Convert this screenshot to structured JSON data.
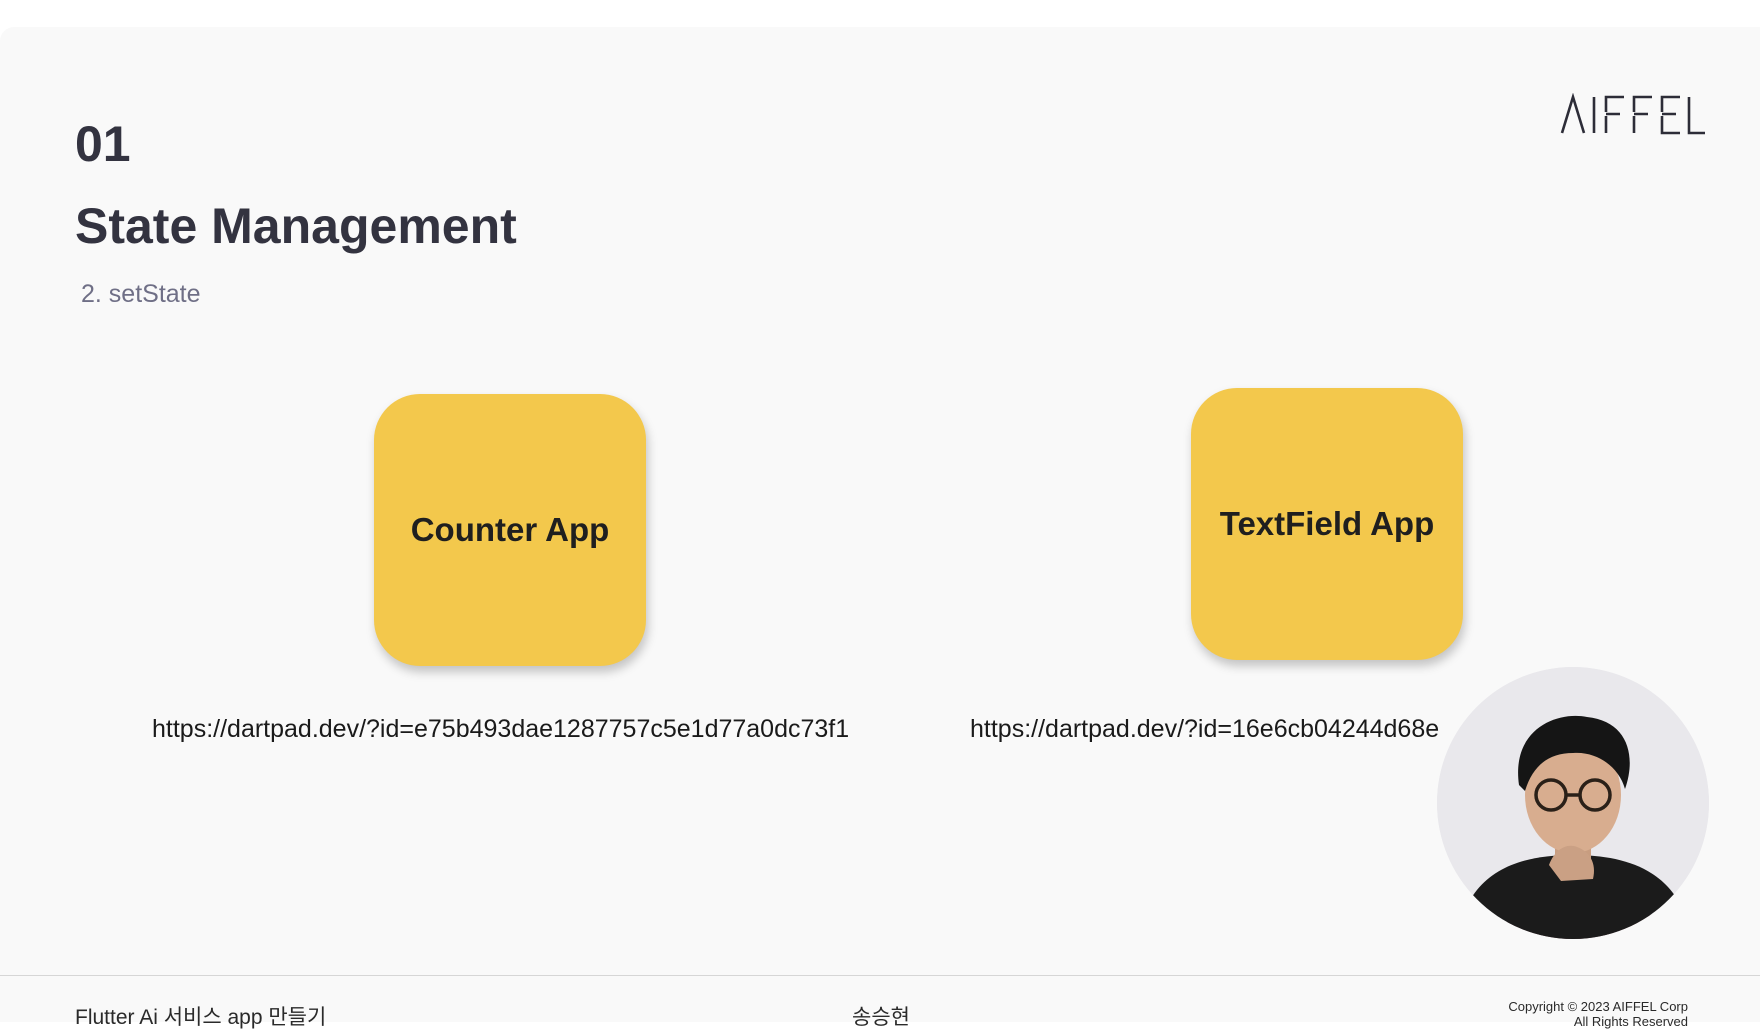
{
  "slide": {
    "section_number": "01",
    "title": "State Management",
    "subtitle": "2. setState",
    "logo_text": "AIFFEL"
  },
  "cards": {
    "counter": {
      "label": "Counter App",
      "url": "https://dartpad.dev/?id=e75b493dae1287757c5e1d77a0dc73f1"
    },
    "textfield": {
      "label": "TextField App",
      "url": "https://dartpad.dev/?id=16e6cb04244d68e"
    }
  },
  "presenter": {
    "icon": "presenter-video"
  },
  "footer": {
    "course": "Flutter Ai 서비스 app 만들기",
    "presenter_name": "송승현",
    "copyright_line1": "Copyright © 2023 AIFFEL Corp",
    "copyright_line2": "All Rights Reserved"
  },
  "colors": {
    "card": "#f3c84c",
    "title": "#333340",
    "subtitle": "#6f6f86",
    "background": "#f9f9f9"
  }
}
